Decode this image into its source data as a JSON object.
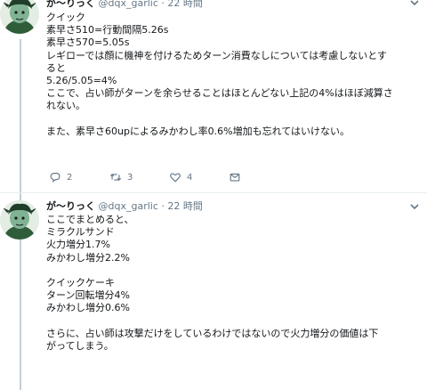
{
  "tweet1": {
    "name": "が〜りっく",
    "handle": "@dqx_garlic",
    "separator": "·",
    "time": "22 時間",
    "lines": [
      "クイック",
      "素早さ510=行動間隔5.26s",
      "素早さ570=5.05s",
      "レギローでは顔に機神を付けるためターン消費なしについては考慮しないとす",
      "ると",
      "5.26/5.05=4%",
      "ここで、占い師がターンを余らせることはほとんどない上記の4%はほぼ減算さ",
      "れない。",
      "",
      "また、素早さ60upによるみかわし率0.6%増加も忘れてはいけない。"
    ],
    "actions": {
      "replies": "2",
      "retweets": "3",
      "likes": "4"
    }
  },
  "tweet2": {
    "name": "が〜りっく",
    "handle": "@dqx_garlic",
    "separator": "·",
    "time": "22 時間",
    "lines": [
      "ここでまとめると、",
      "ミラクルサンド",
      "火力増分1.7%",
      "みかわし増分2.2%",
      "",
      "クイックケーキ",
      "ターン回転増分4%",
      "みかわし増分0.6%",
      "",
      "さらに、占い師は攻撃だけをしているわけではないので火力増分の価値は下",
      "がってしまう。"
    ]
  },
  "icons": [
    "avatar",
    "chevron-down-icon",
    "reply-icon",
    "retweet-icon",
    "like-icon",
    "message-icon"
  ],
  "colors": {
    "text": "#14171a",
    "muted": "#657786",
    "thread_line": "#c4cfd6"
  }
}
